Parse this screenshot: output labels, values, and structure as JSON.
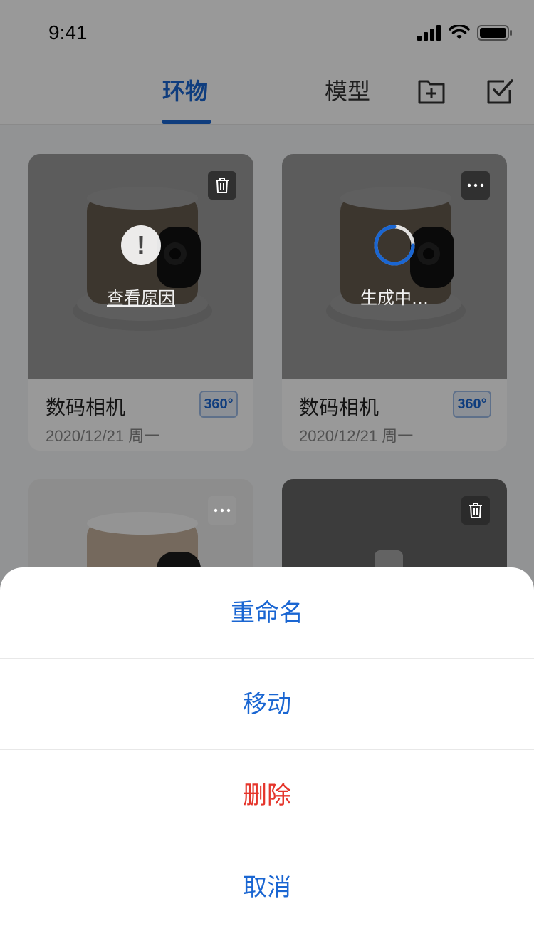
{
  "status_bar": {
    "time": "9:41"
  },
  "nav": {
    "tabs": [
      {
        "label": "环物",
        "active": true
      },
      {
        "label": "模型",
        "active": false
      }
    ],
    "icons": {
      "add_folder": "add-folder-icon",
      "select": "checkbox-icon"
    }
  },
  "cards": [
    {
      "name": "数码相机",
      "date": "2020/12/21  周一",
      "badge": "360°",
      "overlay_text": "查看原因",
      "status": "failed",
      "corner_icon": "trash-icon"
    },
    {
      "name": "数码相机",
      "date": "2020/12/21  周一",
      "badge": "360°",
      "overlay_text": "生成中…",
      "status": "generating",
      "corner_icon": "more-icon"
    },
    {
      "status": "normal",
      "corner_icon": "more-icon"
    },
    {
      "status": "normal",
      "corner_icon": "trash-icon"
    }
  ],
  "action_sheet": {
    "rename": "重命名",
    "move": "移动",
    "delete": "删除",
    "cancel": "取消"
  },
  "colors": {
    "accent": "#1a66d2",
    "danger": "#e5352b"
  }
}
